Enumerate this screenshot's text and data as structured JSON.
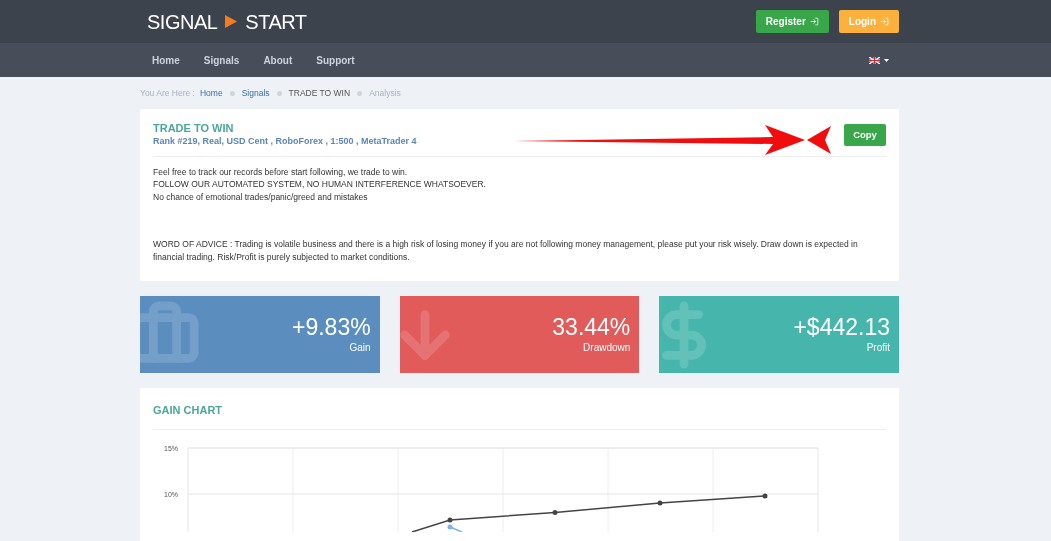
{
  "header": {
    "logo_left": "SIGNAL",
    "logo_right": "START",
    "buttons": [
      {
        "label": "Register",
        "kind": "register"
      },
      {
        "label": "Login",
        "kind": "login"
      }
    ]
  },
  "nav": {
    "items": [
      "Home",
      "Signals",
      "About",
      "Support"
    ]
  },
  "breadcrumb": {
    "prefix": "You Are Here :",
    "items": [
      {
        "label": "Home",
        "kind": "link"
      },
      {
        "label": "Signals",
        "kind": "link"
      },
      {
        "label": "TRADE TO WIN",
        "kind": "text"
      },
      {
        "label": "Analysis",
        "kind": "current"
      }
    ]
  },
  "signal": {
    "title": "TRADE TO WIN",
    "subtitle": "Rank #219, Real, USD Cent , RoboForex , 1:500 , MetaTrader 4",
    "copy_button": "Copy",
    "description": [
      "Feel free to track our records before start following, we trade to win.",
      "FOLLOW OUR AUTOMATED SYSTEM, NO HUMAN INTERFERENCE WHATSOEVER.",
      "No chance of emotional trades/panic/greed and mistakes"
    ],
    "advice": "WORD OF ADVICE : Trading is volatile business and there is a high risk of losing money if you are not following money management, please put your risk wisely. Draw down is expected in financial trading. Risk/Profit is purely subjected to market conditions."
  },
  "stats": [
    {
      "value": "+9.83%",
      "label": "Gain",
      "kind": "briefcase",
      "color": "#5b8ebf"
    },
    {
      "value": "33.44%",
      "label": "Drawdown",
      "kind": "down",
      "color": "#e15b5b"
    },
    {
      "value": "+$442.13",
      "label": "Profit",
      "kind": "dollar",
      "color": "#46b6ad"
    }
  ],
  "gain_chart": {
    "title": "GAIN CHART",
    "axis_labels": [
      "15%",
      "10%"
    ]
  }
}
